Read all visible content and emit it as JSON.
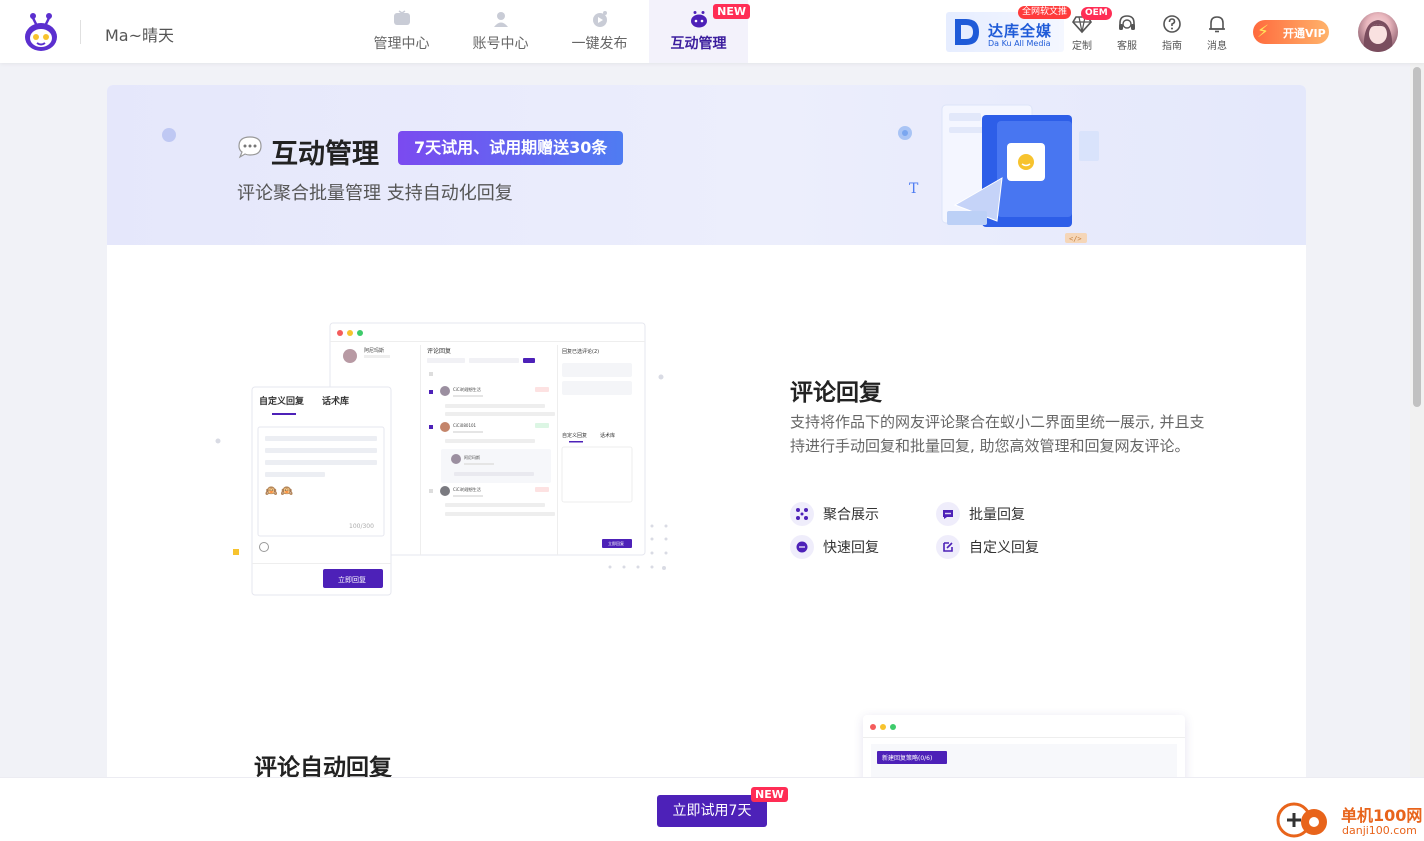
{
  "header": {
    "user_name": "Ma~晴天",
    "nav": [
      {
        "label": "管理中心",
        "icon": "tv-icon"
      },
      {
        "label": "账号中心",
        "icon": "account-icon"
      },
      {
        "label": "一键发布",
        "icon": "publish-icon"
      },
      {
        "label": "互动管理",
        "icon": "chat-robot-icon",
        "active": true,
        "badge": "NEW"
      }
    ],
    "dakus": {
      "name": "达库全媒",
      "sub": "Da Ku All Media",
      "tag": "全网软文推"
    },
    "tools": [
      {
        "label": "定制",
        "icon": "diamond-icon",
        "badge": "OEM"
      },
      {
        "label": "客服",
        "icon": "headset-icon"
      },
      {
        "label": "指南",
        "icon": "help-icon"
      },
      {
        "label": "消息",
        "icon": "bell-icon"
      }
    ],
    "vip_label": "开通VIP"
  },
  "hero": {
    "title": "互动管理",
    "badge": "7天试用、试用期赠送30条",
    "subtitle": "评论聚合批量管理 支持自动化回复"
  },
  "mockup": {
    "panel_title": "评论回复",
    "account_name": "阿尼玛斯",
    "side_title": "回复已选评论(2)",
    "comment_users": [
      "CiCi的理想生活",
      "CiCi080101",
      "阿尼玛斯",
      "CiCi的理想生活"
    ],
    "popup_tabs": [
      "自定义回复",
      "话术库"
    ],
    "char_count": "100/300",
    "popup_button": "立即回复",
    "small_button": "立即回复",
    "emoji": "🙉 🙉"
  },
  "feature": {
    "title": "评论回复",
    "description": "支持将作品下的网友评论聚合在蚁小二界面里统一展示, 并且支持进行手动回复和批量回复, 助您高效管理和回复网友评论。",
    "items": [
      {
        "label": "聚合展示",
        "icon": "aggregate-icon"
      },
      {
        "label": "批量回复",
        "icon": "batch-reply-icon"
      },
      {
        "label": "快速回复",
        "icon": "quick-reply-icon"
      },
      {
        "label": "自定义回复",
        "icon": "custom-reply-icon"
      }
    ]
  },
  "section2": {
    "title": "评论自动回复",
    "mock_button": "新建回复策略(0/6)"
  },
  "bottom": {
    "cta_label": "立即试用7天",
    "cta_badge": "NEW"
  },
  "watermark": {
    "name": "单机100网",
    "url": "danji100.com"
  },
  "colors": {
    "brand_purple": "#4d21b8",
    "new_badge": "#ff2d55",
    "hero_badge_start": "#7b4af0",
    "hero_badge_end": "#4f7cf2",
    "dakus_blue": "#1f5bd8"
  }
}
